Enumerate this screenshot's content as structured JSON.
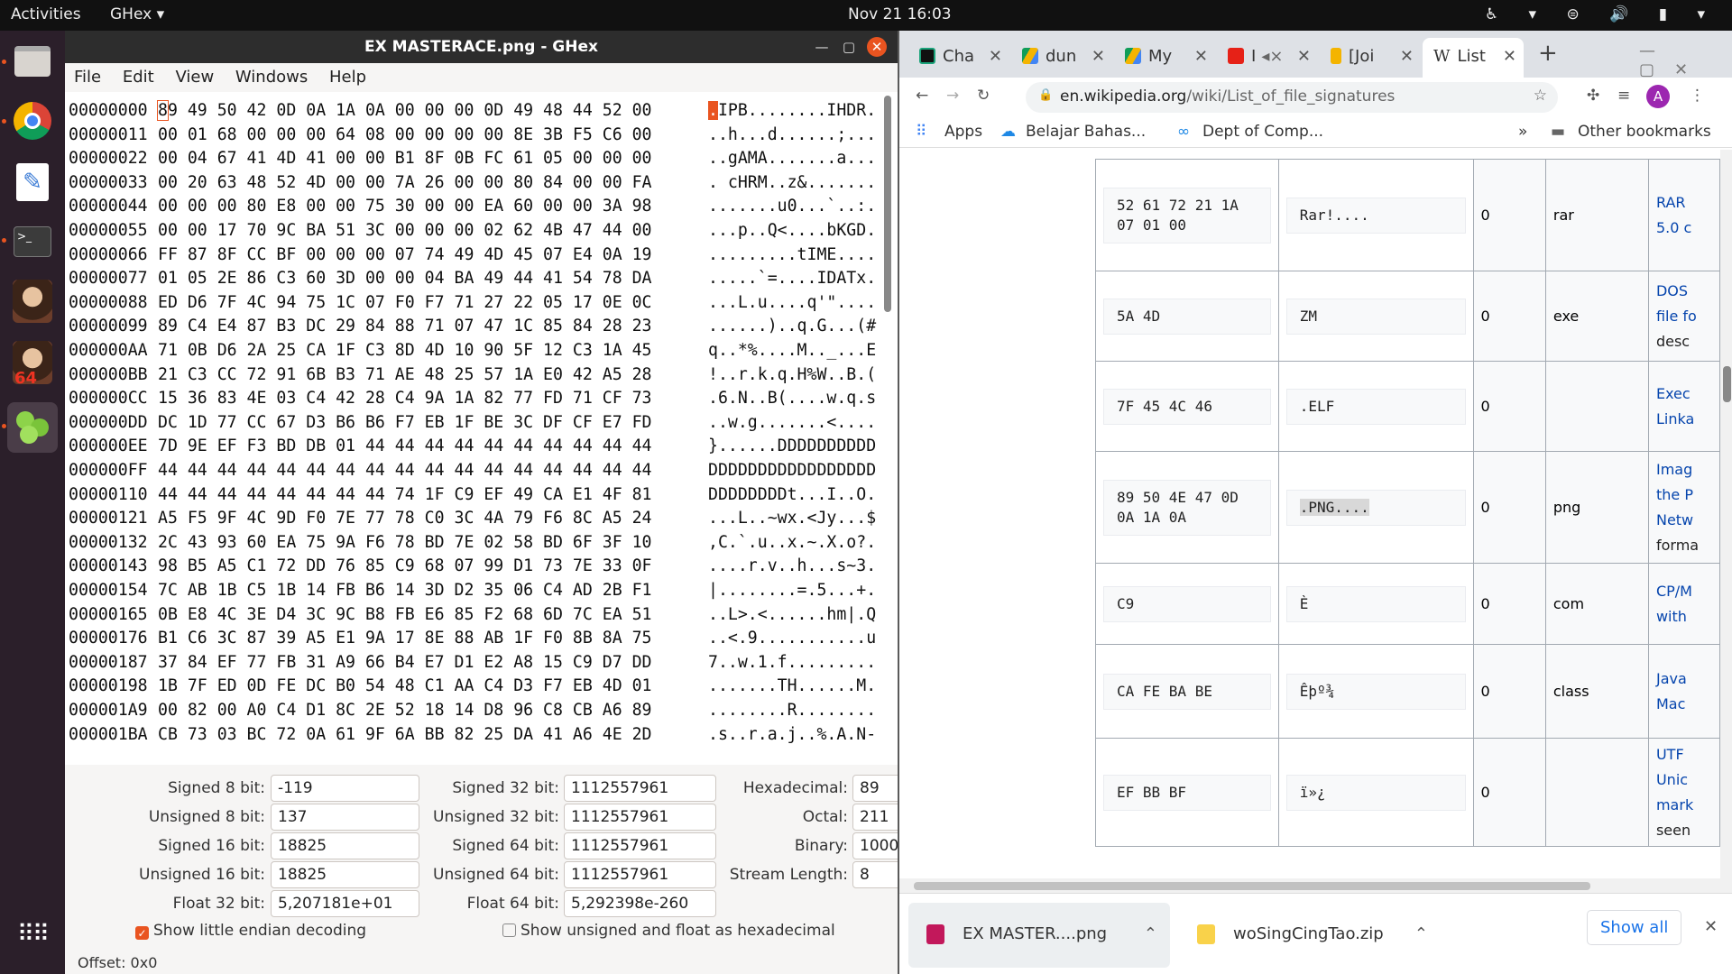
{
  "topbar": {
    "activities": "Activities",
    "app_menu": "GHex ▾",
    "clock": "Nov 21  16:03",
    "tray": "♿ ▾ ⊜ 🔊 ▮ ▾"
  },
  "dock": {
    "apps": [
      "files",
      "chrome",
      "text-editor",
      "terminal",
      "avatar-1",
      "avatar-2",
      "ghex",
      "app-grid"
    ],
    "badge": "64"
  },
  "ghex": {
    "title": "EX MASTERACE.png - GHex",
    "menu": [
      "File",
      "Edit",
      "View",
      "Windows",
      "Help"
    ],
    "rows": [
      {
        "off": "00000000",
        "hex": "89 49 50 42 0D 0A 1A 0A 00 00 00 0D 49 48 44 52 00",
        "asc": ".IPB........IHDR."
      },
      {
        "off": "00000011",
        "hex": "00 01 68 00 00 00 64 08 00 00 00 00 8E 3B F5 C6 00",
        "asc": "..h...d......;..."
      },
      {
        "off": "00000022",
        "hex": "00 04 67 41 4D 41 00 00 B1 8F 0B FC 61 05 00 00 00",
        "asc": "..gAMA.......a..."
      },
      {
        "off": "00000033",
        "hex": "00 20 63 48 52 4D 00 00 7A 26 00 00 80 84 00 00 FA",
        "asc": ". cHRM..z&......."
      },
      {
        "off": "00000044",
        "hex": "00 00 00 80 E8 00 00 75 30 00 00 EA 60 00 00 3A 98",
        "asc": ".......u0...`..:."
      },
      {
        "off": "00000055",
        "hex": "00 00 17 70 9C BA 51 3C 00 00 00 02 62 4B 47 44 00",
        "asc": "...p..Q<....bKGD."
      },
      {
        "off": "00000066",
        "hex": "FF 87 8F CC BF 00 00 00 07 74 49 4D 45 07 E4 0A 19",
        "asc": ".........tIME...."
      },
      {
        "off": "00000077",
        "hex": "01 05 2E 86 C3 60 3D 00 00 04 BA 49 44 41 54 78 DA",
        "asc": ".....`=....IDATx."
      },
      {
        "off": "00000088",
        "hex": "ED D6 7F 4C 94 75 1C 07 F0 F7 71 27 22 05 17 0E 0C",
        "asc": "...L.u....q'\"...."
      },
      {
        "off": "00000099",
        "hex": "89 C4 E4 87 B3 DC 29 84 88 71 07 47 1C 85 84 28 23",
        "asc": "......)..q.G...(#"
      },
      {
        "off": "000000AA",
        "hex": "71 0B D6 2A 25 CA 1F C3 8D 4D 10 90 5F 12 C3 1A 45",
        "asc": "q..*%....M.._...E"
      },
      {
        "off": "000000BB",
        "hex": "21 C3 CC 72 91 6B B3 71 AE 48 25 57 1A E0 42 A5 28",
        "asc": "!..r.k.q.H%W..B.("
      },
      {
        "off": "000000CC",
        "hex": "15 36 83 4E 03 C4 42 28 C4 9A 1A 82 77 FD 71 CF 73",
        "asc": ".6.N..B(....w.q.s"
      },
      {
        "off": "000000DD",
        "hex": "DC 1D 77 CC 67 D3 B6 B6 F7 EB 1F BE 3C DF CF E7 FD",
        "asc": "..w.g.......<...."
      },
      {
        "off": "000000EE",
        "hex": "7D 9E EF F3 BD DB 01 44 44 44 44 44 44 44 44 44 44",
        "asc": "}......DDDDDDDDDD"
      },
      {
        "off": "000000FF",
        "hex": "44 44 44 44 44 44 44 44 44 44 44 44 44 44 44 44 44",
        "asc": "DDDDDDDDDDDDDDDDD"
      },
      {
        "off": "00000110",
        "hex": "44 44 44 44 44 44 44 44 74 1F C9 EF 49 CA E1 4F 81",
        "asc": "DDDDDDDDt...I..O."
      },
      {
        "off": "00000121",
        "hex": "A5 F5 9F 4C 9D F0 7E 77 78 C0 3C 4A 79 F6 8C A5 24",
        "asc": "...L..~wx.<Jy...$"
      },
      {
        "off": "00000132",
        "hex": "2C 43 93 60 EA 75 9A F6 78 BD 7E 02 58 BD 6F 3F 10",
        "asc": ",C.`.u..x.~.X.o?."
      },
      {
        "off": "00000143",
        "hex": "98 B5 A5 C1 72 DD 76 85 C9 68 07 99 D1 73 7E 33 0F",
        "asc": "....r.v..h...s~3."
      },
      {
        "off": "00000154",
        "hex": "7C AB 1B C5 1B 14 FB B6 14 3D D2 35 06 C4 AD 2B F1",
        "asc": "|........=.5...+."
      },
      {
        "off": "00000165",
        "hex": "0B E8 4C 3E D4 3C 9C B8 FB E6 85 F2 68 6D 7C EA 51",
        "asc": "..L>.<......hm|.Q"
      },
      {
        "off": "00000176",
        "hex": "B1 C6 3C 87 39 A5 E1 9A 17 8E 88 AB 1F F0 8B 8A 75",
        "asc": "..<.9...........u"
      },
      {
        "off": "00000187",
        "hex": "37 84 EF 77 FB 31 A9 66 B4 E7 D1 E2 A8 15 C9 D7 DD",
        "asc": "7..w.1.f........."
      },
      {
        "off": "00000198",
        "hex": "1B 7F ED 0D FE DC B0 54 48 C1 AA C4 D3 F7 EB 4D 01",
        "asc": ".......TH......M."
      },
      {
        "off": "000001A9",
        "hex": "00 82 00 A0 C4 D1 8C 2E 52 18 14 D8 96 C8 CB A6 89",
        "asc": "........R........"
      },
      {
        "off": "000001BA",
        "hex": "CB 73 03 BC 72 0A 61 9F 6A BB 82 25 DA 41 A6 4E 2D",
        "asc": ".s..r.a.j..%.A.N-"
      }
    ],
    "decode": {
      "signed8_label": "Signed 8 bit:",
      "signed8": "-119",
      "unsigned8_label": "Unsigned 8 bit:",
      "unsigned8": "137",
      "signed16_label": "Signed 16 bit:",
      "signed16": "18825",
      "unsigned16_label": "Unsigned 16 bit:",
      "unsigned16": "18825",
      "float32_label": "Float 32 bit:",
      "float32": "5,207181e+01",
      "signed32_label": "Signed 32 bit:",
      "signed32": "1112557961",
      "unsigned32_label": "Unsigned 32 bit:",
      "unsigned32": "1112557961",
      "signed64_label": "Signed 64 bit:",
      "signed64": "1112557961",
      "unsigned64_label": "Unsigned 64 bit:",
      "unsigned64": "1112557961",
      "float64_label": "Float 64 bit:",
      "float64": "5,292398e-260",
      "hex_label": "Hexadecimal:",
      "hex": "89",
      "octal_label": "Octal:",
      "octal": "211",
      "binary_label": "Binary:",
      "binary": "10001001",
      "stream_label": "Stream Length:",
      "stream": "8",
      "little_endian": "Show little endian decoding",
      "unsigned_hex": "Show unsigned and float as hexadecimal",
      "offset": "Offset: 0x0"
    }
  },
  "chrome": {
    "tabs": [
      "Cha",
      "dun",
      "My",
      "I",
      "[Joi",
      "List"
    ],
    "url_host": "en.wikipedia.org",
    "url_path": "/wiki/List_of_file_signatures",
    "bookmarks": {
      "apps": "Apps",
      "b1": "Belajar Bahas...",
      "b2": "Dept of Comp...",
      "more": "»",
      "other": "Other bookmarks"
    },
    "table": [
      {
        "hex": [
          "52 61 72 21 1A",
          "07 01 00"
        ],
        "iso": "Rar!....",
        "offset": "0",
        "ext": "rar",
        "desc": [
          "RAR",
          "5.0 c"
        ]
      },
      {
        "hex": [
          "5A 4D"
        ],
        "iso": "ZM",
        "offset": "0",
        "ext": "exe",
        "desc": [
          "DOS",
          "file fo",
          "desc"
        ]
      },
      {
        "hex": [
          "7F 45 4C 46"
        ],
        "iso": ".ELF",
        "offset": "0",
        "ext": "",
        "desc": [
          "Exec",
          "Linka"
        ]
      },
      {
        "hex": [
          "89 50 4E 47 0D",
          "0A 1A 0A"
        ],
        "iso": ".PNG....",
        "offset": "0",
        "ext": "png",
        "desc": [
          "Imag",
          "the P",
          "Netw",
          "forma"
        ]
      },
      {
        "hex": [
          "C9"
        ],
        "iso": "È",
        "offset": "0",
        "ext": "com",
        "desc": [
          "CP/M",
          "with"
        ]
      },
      {
        "hex": [
          "CA FE BA BE"
        ],
        "iso": "Êþº¾",
        "offset": "0",
        "ext": "class",
        "desc": [
          "Java",
          "Mac"
        ]
      },
      {
        "hex": [
          "EF BB BF"
        ],
        "iso": "ï»¿",
        "offset": "0",
        "ext": "",
        "desc": [
          "UTF",
          "Unic",
          "mark",
          "seen"
        ]
      }
    ],
    "downloads": {
      "d1": "EX MASTER....png",
      "d2": "woSingCingTao.zip",
      "show_all": "Show all"
    }
  }
}
